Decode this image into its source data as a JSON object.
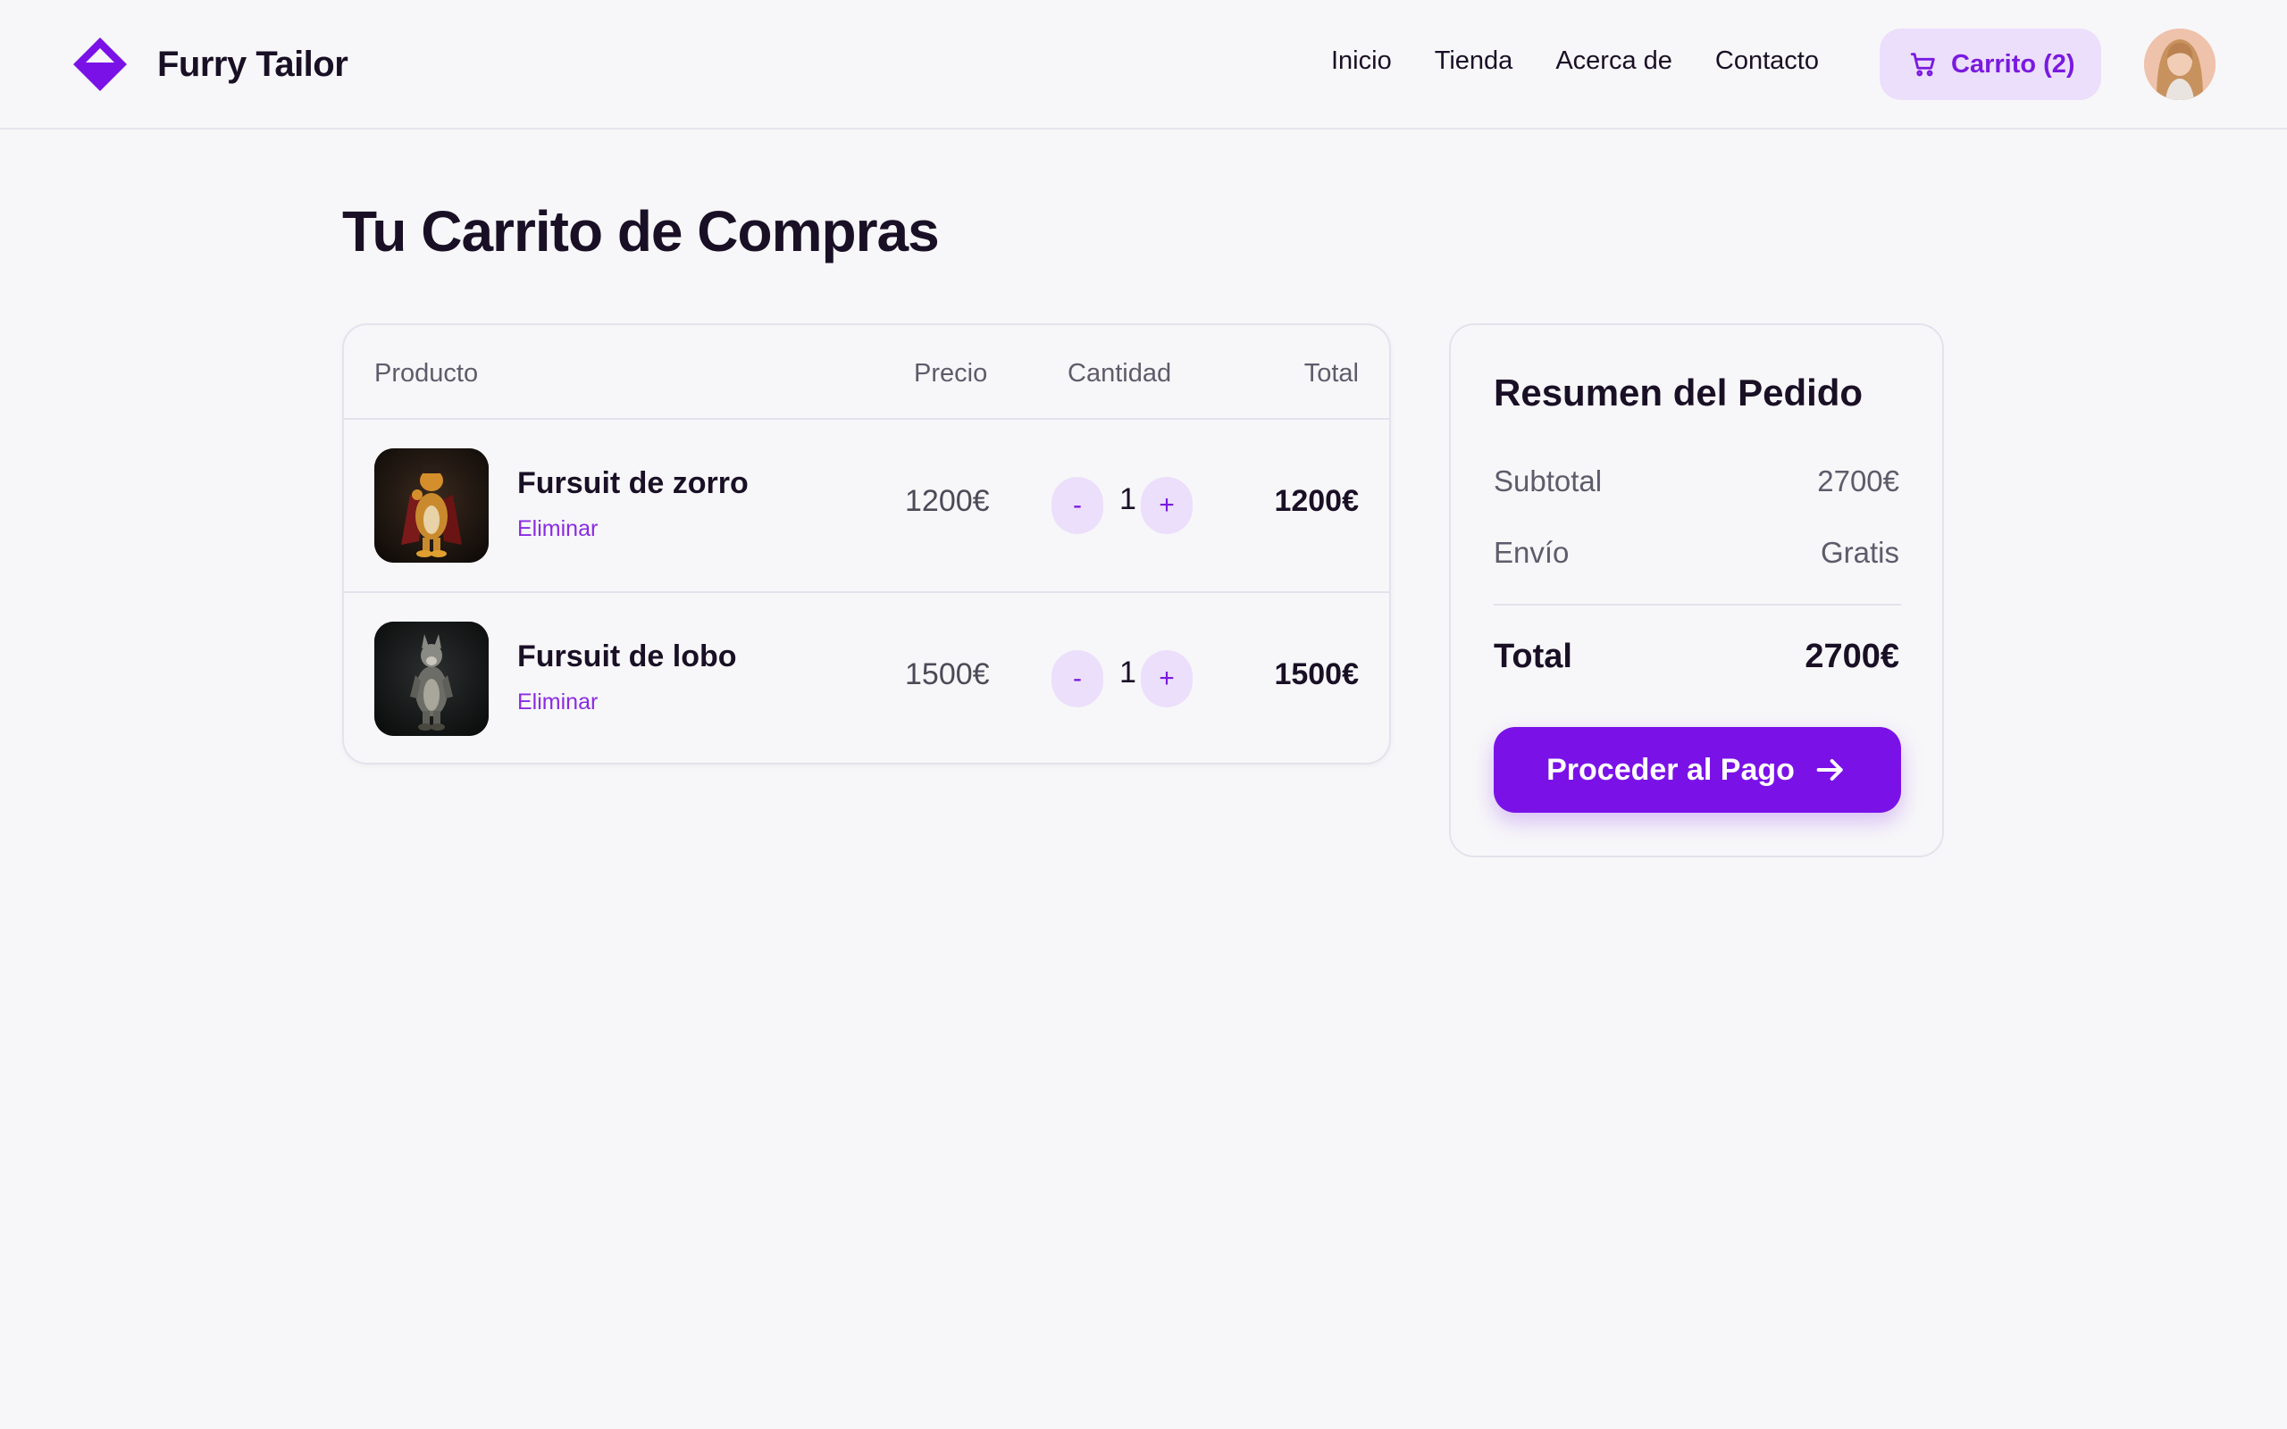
{
  "brand": {
    "name": "Furry Tailor",
    "logo_icon": "diamond-logo-icon",
    "accent_color": "#7a12e8"
  },
  "nav": {
    "items": [
      {
        "label": "Inicio"
      },
      {
        "label": "Tienda"
      },
      {
        "label": "Acerca de"
      },
      {
        "label": "Contacto"
      }
    ],
    "cart_label": "Carrito (2)",
    "cart_icon": "shopping-cart-icon",
    "avatar_icon": "user-avatar"
  },
  "page": {
    "title": "Tu Carrito de Compras"
  },
  "cart": {
    "columns": {
      "product": "Producto",
      "price": "Precio",
      "quantity": "Cantidad",
      "total": "Total"
    },
    "items": [
      {
        "name": "Fursuit de zorro",
        "remove_label": "Eliminar",
        "price": "1200€",
        "quantity": "1",
        "total": "1200€",
        "minus_label": "-",
        "plus_label": "+"
      },
      {
        "name": "Fursuit de lobo",
        "remove_label": "Eliminar",
        "price": "1500€",
        "quantity": "1",
        "total": "1500€",
        "minus_label": "-",
        "plus_label": "+"
      }
    ]
  },
  "summary": {
    "title": "Resumen del Pedido",
    "subtotal_label": "Subtotal",
    "subtotal_value": "2700€",
    "shipping_label": "Envío",
    "shipping_value": "Gratis",
    "total_label": "Total",
    "total_value": "2700€",
    "checkout_label": "Proceder al Pago",
    "checkout_icon": "arrow-right-icon"
  }
}
